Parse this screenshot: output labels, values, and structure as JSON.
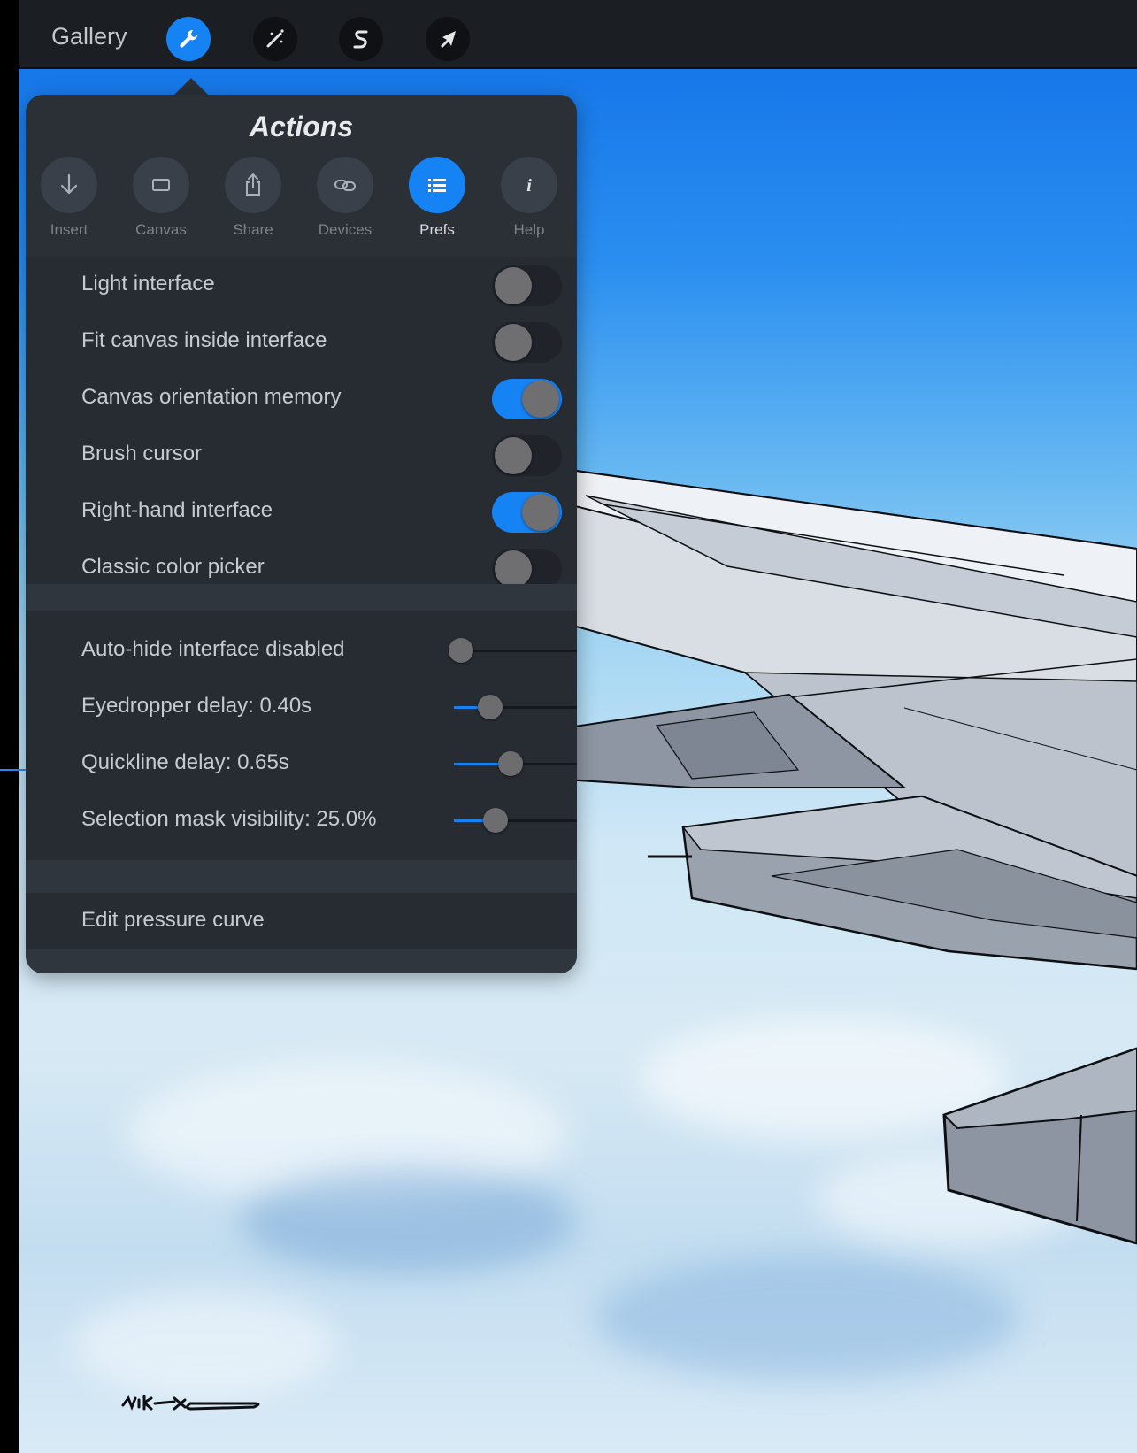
{
  "toolbar": {
    "gallery_label": "Gallery",
    "tools": [
      {
        "name": "actions",
        "icon": "wrench-icon",
        "active": true
      },
      {
        "name": "adjustments",
        "icon": "magic-wand-icon",
        "active": false
      },
      {
        "name": "selection",
        "icon": "selection-s-icon",
        "active": false
      },
      {
        "name": "transform",
        "icon": "arrow-cursor-icon",
        "active": false
      }
    ]
  },
  "actions": {
    "title": "Actions",
    "tabs": [
      {
        "label": "Insert",
        "icon": "download-arrow-icon"
      },
      {
        "label": "Canvas",
        "icon": "rectangle-icon"
      },
      {
        "label": "Share",
        "icon": "share-icon"
      },
      {
        "label": "Devices",
        "icon": "link-icon"
      },
      {
        "label": "Prefs",
        "icon": "list-icon"
      },
      {
        "label": "Help",
        "icon": "info-icon"
      }
    ],
    "active_tab": "Prefs",
    "toggles": [
      {
        "label": "Light interface",
        "on": false
      },
      {
        "label": "Fit canvas inside interface",
        "on": false
      },
      {
        "label": "Canvas orientation memory",
        "on": true
      },
      {
        "label": "Brush cursor",
        "on": false
      },
      {
        "label": "Right-hand interface",
        "on": true
      },
      {
        "label": "Classic color picker",
        "on": false
      }
    ],
    "sliders": [
      {
        "label": "Auto-hide interface disabled",
        "value": 0.0
      },
      {
        "label": "Eyedropper delay: 0.40s",
        "value": 0.27
      },
      {
        "label": "Quickline delay: 0.65s",
        "value": 0.42
      },
      {
        "label": "Selection mask visibility: 25.0%",
        "value": 0.31
      }
    ],
    "pressure_curve_label": "Edit pressure curve"
  },
  "colors": {
    "accent": "#1683f5",
    "panel": "#2b3037",
    "toolbar": "#1b1e23"
  }
}
